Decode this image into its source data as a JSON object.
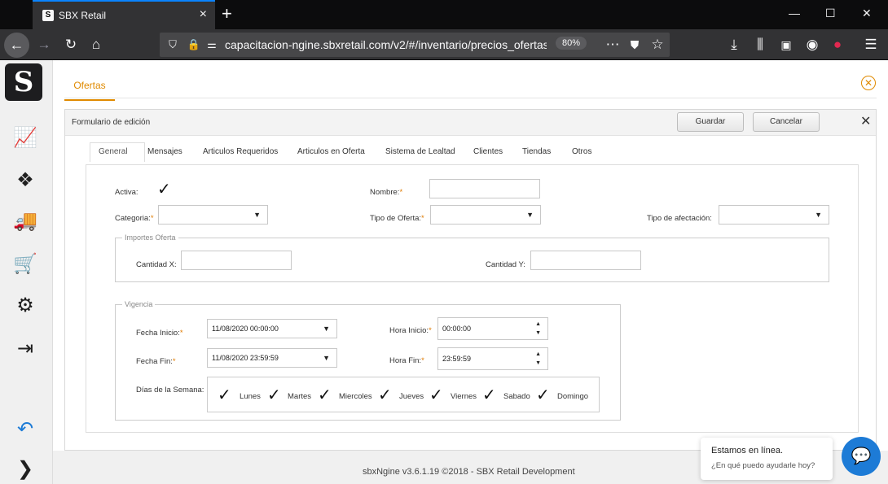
{
  "browser": {
    "tab_title": "SBX Retail",
    "tab_favicon": "S",
    "new_tab": "+",
    "url": "capacitacion-ngine.sbxretail.com/v2/#/inventario/precios_ofertas/",
    "zoom": "80%",
    "window_controls": {
      "minimize": "—",
      "maximize": "☐",
      "close": "✕"
    }
  },
  "sidebar": {
    "logo": "S",
    "icons": [
      "chart-line-icon",
      "dropbox-icon",
      "truck-icon",
      "cart-icon",
      "gear-icon",
      "logout-icon",
      "undo-icon",
      "chevron-right-icon"
    ]
  },
  "page": {
    "tab_label": "Ofertas",
    "close_glyph": "✕"
  },
  "form": {
    "title": "Formulario de edición",
    "save_label": "Guardar",
    "cancel_label": "Cancelar",
    "close_glyph": "✕",
    "tabs": [
      "General",
      "Mensajes",
      "Articulos Requeridos",
      "Articulos en Oferta",
      "Sistema de Lealtad",
      "Clientes",
      "Tiendas",
      "Otros"
    ],
    "active_tab": "General",
    "fields": {
      "activa_label": "Activa:",
      "activa_checked": true,
      "nombre_label": "Nombre:",
      "nombre_value": "",
      "categoria_label": "Categoria:",
      "categoria_value": "",
      "tipo_oferta_label": "Tipo de Oferta:",
      "tipo_oferta_value": "",
      "tipo_afectacion_label": "Tipo de afectación:",
      "tipo_afectacion_value": "",
      "required_mark": "*"
    },
    "importes": {
      "legend": "Importes Oferta",
      "cantidad_x_label": "Cantidad X:",
      "cantidad_x_value": "",
      "cantidad_y_label": "Cantidad Y:",
      "cantidad_y_value": ""
    },
    "vigencia": {
      "legend": "Vigencia",
      "fecha_inicio_label": "Fecha Inicio:",
      "fecha_inicio_value": "11/08/2020 00:00:00",
      "hora_inicio_label": "Hora Inicio:",
      "hora_inicio_value": "00:00:00",
      "fecha_fin_label": "Fecha Fin:",
      "fecha_fin_value": "11/08/2020 23:59:59",
      "hora_fin_label": "Hora Fin:",
      "hora_fin_value": "23:59:59",
      "dias_label": "Días de la Semana:",
      "days": [
        "Lunes",
        "Martes",
        "Miercoles",
        "Jueves",
        "Viernes",
        "Sabado",
        "Domingo"
      ],
      "days_checked": [
        true,
        true,
        true,
        true,
        true,
        true,
        true
      ]
    }
  },
  "footer": {
    "text": "sbxNgine v3.6.1.19 ©2018 - SBX Retail Development"
  },
  "chat": {
    "line1": "Estamos en línea.",
    "line2": "¿En qué puedo ayudarle hoy?"
  },
  "colors": {
    "accent": "#e08a00",
    "chat_blue": "#1d7bd6"
  }
}
